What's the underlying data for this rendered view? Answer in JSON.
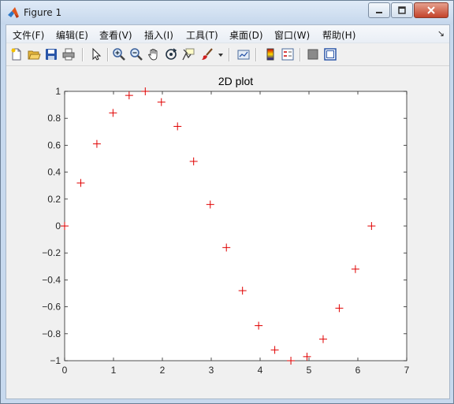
{
  "window": {
    "title": "Figure 1",
    "minimize_icon": "minimize-icon",
    "maximize_icon": "maximize-icon",
    "close_icon": "close-icon"
  },
  "menubar": {
    "items": [
      {
        "label": "文件(F)"
      },
      {
        "label": "编辑(E)"
      },
      {
        "label": "查看(V)"
      },
      {
        "label": "插入(I)"
      },
      {
        "label": "工具(T)"
      },
      {
        "label": "桌面(D)"
      },
      {
        "label": "窗口(W)"
      },
      {
        "label": "帮助(H)"
      }
    ],
    "more_glyph": "↘"
  },
  "toolbar": {
    "icons": [
      "new-figure-icon",
      "open-file-icon",
      "save-icon",
      "print-icon",
      "select-arrow-icon",
      "zoom-in-icon",
      "zoom-out-icon",
      "pan-hand-icon",
      "rotate-3d-icon",
      "data-cursor-icon",
      "brush-icon",
      "brush-dropdown-icon",
      "link-plot-icon",
      "colorbar-icon",
      "legend-icon",
      "hide-plot-tools-icon",
      "show-plot-tools-icon"
    ]
  },
  "colors": {
    "marker": "#e00000",
    "axes_bg": "#ffffff",
    "figure_bg": "#f0f0f0"
  },
  "chart_data": {
    "type": "scatter",
    "title": "2D plot",
    "xlabel": "",
    "ylabel": "",
    "xlim": [
      0,
      7
    ],
    "ylim": [
      -1,
      1
    ],
    "xticks": [
      "0",
      "1",
      "2",
      "3",
      "4",
      "5",
      "6",
      "7"
    ],
    "yticks": [
      "-1",
      "-0.8",
      "-0.6",
      "-0.4",
      "-0.2",
      "0",
      "0.2",
      "0.4",
      "0.6",
      "0.8",
      "1"
    ],
    "grid": false,
    "marker": "+",
    "series": [
      {
        "x": [
          0,
          0.33,
          0.66,
          0.99,
          1.32,
          1.65,
          1.98,
          2.31,
          2.64,
          2.98,
          3.31,
          3.64,
          3.97,
          4.3,
          4.63,
          4.96,
          5.29,
          5.62,
          5.95,
          6.28
        ],
        "y": [
          0,
          0.32,
          0.61,
          0.84,
          0.97,
          1.0,
          0.92,
          0.74,
          0.48,
          0.16,
          -0.16,
          -0.48,
          -0.74,
          -0.92,
          -1.0,
          -0.97,
          -0.84,
          -0.61,
          -0.32,
          0
        ]
      }
    ]
  }
}
